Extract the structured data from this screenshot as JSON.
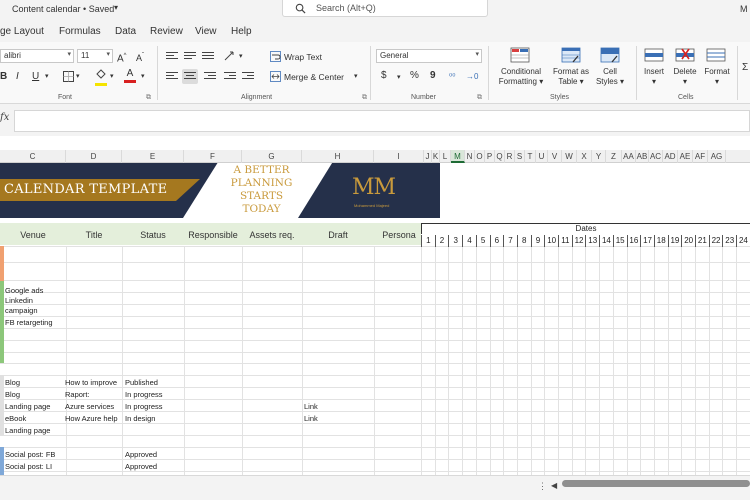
{
  "titlebar": {
    "doc_title": "Content calendar • Saved",
    "search_placeholder": "Search (Alt+Q)",
    "user_initial": "M"
  },
  "menu": [
    "ge Layout",
    "Formulas",
    "Data",
    "Review",
    "View",
    "Help"
  ],
  "ribbon": {
    "font_name": "alibri",
    "font_size": "11",
    "grow_label": "A",
    "shrink_label": "A",
    "bold": "B",
    "italic": "I",
    "underline": "U",
    "fill_label": "A",
    "font_color_label": "A",
    "wrap_text": "Wrap Text",
    "merge_center": "Merge & Center",
    "number_format": "General",
    "currency": "$",
    "percent": "%",
    "comma": "9",
    "conditional_formatting": [
      "Conditional",
      "Formatting"
    ],
    "format_as_table": [
      "Format as",
      "Table"
    ],
    "cell_styles": [
      "Cell",
      "Styles"
    ],
    "insert": "Insert",
    "delete": "Delete",
    "format": "Format",
    "groups": {
      "font": "Font",
      "alignment": "Alignment",
      "number": "Number",
      "styles": "Styles",
      "cells": "Cells"
    }
  },
  "formula_bar": {
    "fx": "fx",
    "value": ""
  },
  "columns": [
    "C",
    "D",
    "E",
    "F",
    "G",
    "H",
    "I",
    "J",
    "K",
    "L",
    "M",
    "N",
    "O",
    "P",
    "Q",
    "R",
    "S",
    "T",
    "U",
    "V",
    "W",
    "X",
    "Y",
    "Z",
    "AA",
    "AB",
    "AC",
    "AD",
    "AE",
    "AF",
    "AG"
  ],
  "active_column": "M",
  "banner": {
    "title": "CALENDAR TEMPLATE",
    "slogan": [
      "A BETTER",
      "PLANNING",
      "STARTS",
      "TODAY"
    ],
    "logo": "MM",
    "logo_name": "Mohammed Majeed"
  },
  "table": {
    "headers": [
      "Venue",
      "Title",
      "Status",
      "Responsible",
      "Assets req.",
      "Draft",
      "Persona"
    ],
    "dates_title": "Dates",
    "days": [
      1,
      2,
      3,
      4,
      5,
      6,
      7,
      8,
      9,
      10,
      11,
      12,
      13,
      14,
      15,
      16,
      17,
      18,
      19,
      20,
      21,
      22,
      23,
      24
    ],
    "rows": [
      {
        "venue": "Google ads",
        "title": "",
        "status": "",
        "draft": ""
      },
      {
        "venue": "Linkedin",
        "title": "",
        "status": "",
        "draft": ""
      },
      {
        "venue": "campaign",
        "title": "",
        "status": "",
        "draft": ""
      },
      {
        "venue": "FB retargeting",
        "title": "",
        "status": "",
        "draft": ""
      },
      {
        "venue": "Blog",
        "title": "How to improve",
        "status": "Published",
        "draft": ""
      },
      {
        "venue": "Blog",
        "title": "Raport:",
        "status": "In progress",
        "draft": ""
      },
      {
        "venue": "Landing page",
        "title": "Azure services",
        "status": "In progress",
        "draft": "Link"
      },
      {
        "venue": "eBook",
        "title": "How Azure help",
        "status": "In design",
        "draft": "Link"
      },
      {
        "venue": "Landing page",
        "title": "",
        "status": "",
        "draft": ""
      },
      {
        "venue": "Social post: FB",
        "title": "",
        "status": "Approved",
        "draft": ""
      },
      {
        "venue": "Social post: LI",
        "title": "",
        "status": "Approved",
        "draft": ""
      }
    ]
  },
  "colors": {
    "navy": "#25304a",
    "gold": "#a5781f",
    "header_green": "#e4efdb",
    "bar_orange": "#f0a070",
    "bar_green": "#8cc77a",
    "bar_blue": "#7fa8d8",
    "excel_green": "#1e6b35"
  }
}
